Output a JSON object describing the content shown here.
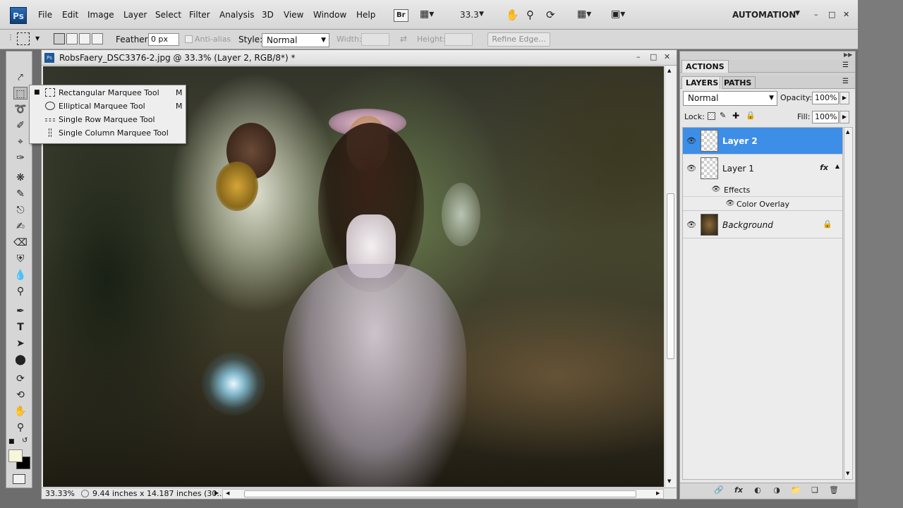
{
  "app": {
    "logo": "Ps",
    "menu": [
      "File",
      "Edit",
      "Image",
      "Layer",
      "Select",
      "Filter",
      "Analysis",
      "3D",
      "View",
      "Window",
      "Help"
    ],
    "bridge_label": "Br",
    "zoom_level": "33.3",
    "workspace": "AUTOMATION",
    "window_controls": [
      "–",
      "□",
      "✕"
    ]
  },
  "options": {
    "feather_label": "Feather:",
    "feather_value": "0 px",
    "antialias_label": "Anti-alias",
    "style_label": "Style:",
    "style_value": "Normal",
    "width_label": "Width:",
    "height_label": "Height:",
    "refine_edge": "Refine Edge..."
  },
  "document": {
    "ps_icon": "Ps",
    "title": "RobsFaery_DSC3376-2.jpg @ 33.3% (Layer 2, RGB/8*) *",
    "zoom": "33.33%",
    "doc_info": "9.44 inches x 14.187 inches (30..."
  },
  "flyout": {
    "items": [
      {
        "label": "Rectangular Marquee Tool",
        "key": "M",
        "selected": true
      },
      {
        "label": "Elliptical Marquee Tool",
        "key": "M",
        "selected": false
      },
      {
        "label": "Single Row Marquee Tool",
        "key": "",
        "selected": false
      },
      {
        "label": "Single Column Marquee Tool",
        "key": "",
        "selected": false
      }
    ]
  },
  "panels": {
    "actions_tab": "ACTIONS",
    "layers_tab": "LAYERS",
    "paths_tab": "PATHS",
    "blend_mode": "Normal",
    "opacity_label": "Opacity:",
    "opacity_value": "100%",
    "lock_label": "Lock:",
    "fill_label": "Fill:",
    "fill_value": "100%",
    "layers": [
      {
        "name": "Layer 2",
        "selected": true
      },
      {
        "name": "Layer 1",
        "selected": false,
        "badge": "fx"
      },
      {
        "name": "Background",
        "selected": false
      }
    ],
    "effects_label": "Effects",
    "color_overlay_label": "Color Overlay"
  },
  "colors": {
    "selection_blue": "#3d8ee6",
    "foreground": "#f6f6da",
    "background": "#000000"
  },
  "icons": {
    "tools": [
      "move-tool-icon",
      "rectangular-marquee-tool-icon",
      "lasso-tool-icon",
      "quick-selection-tool-icon",
      "crop-tool-icon",
      "eyedropper-tool-icon",
      "spot-healing-brush-icon",
      "brush-tool-icon",
      "clone-stamp-icon",
      "history-brush-icon",
      "eraser-tool-icon",
      "paint-bucket-icon",
      "blur-tool-icon",
      "dodge-tool-icon",
      "pen-tool-icon",
      "type-tool-icon",
      "path-selection-icon",
      "ellipse-shape-icon",
      "3d-rotate-icon",
      "3d-orbit-icon",
      "hand-tool-icon",
      "zoom-tool-icon"
    ]
  }
}
